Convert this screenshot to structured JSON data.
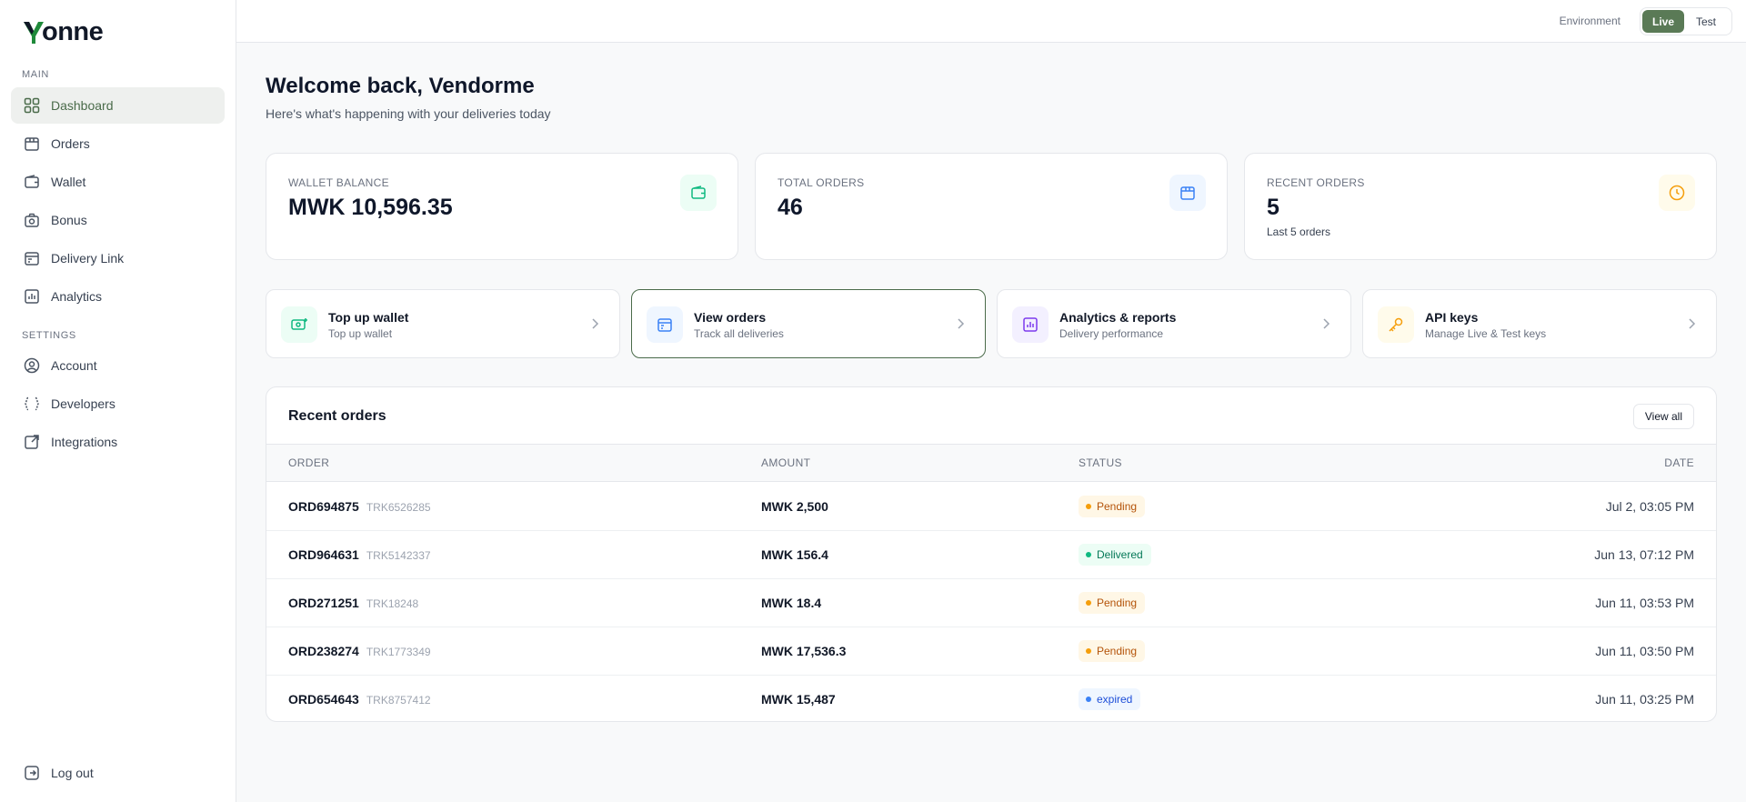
{
  "brand": {
    "name": "onne"
  },
  "sidebar": {
    "main_label": "MAIN",
    "settings_label": "SETTINGS",
    "items": [
      {
        "label": "Dashboard",
        "icon": "grid-icon",
        "active": true
      },
      {
        "label": "Orders",
        "icon": "package-icon"
      },
      {
        "label": "Wallet",
        "icon": "wallet-icon"
      },
      {
        "label": "Bonus",
        "icon": "gift-icon"
      },
      {
        "label": "Delivery Link",
        "icon": "calendar-icon"
      },
      {
        "label": "Analytics",
        "icon": "bar-chart-icon"
      }
    ],
    "settings_items": [
      {
        "label": "Account",
        "icon": "user-circle-icon"
      },
      {
        "label": "Developers",
        "icon": "code-braces-icon"
      },
      {
        "label": "Integrations",
        "icon": "external-link-icon"
      }
    ],
    "logout_label": "Log out"
  },
  "topbar": {
    "env_label": "Environment",
    "live_label": "Live",
    "test_label": "Test"
  },
  "welcome": {
    "title": "Welcome back, Vendorme",
    "subtitle": "Here's what's happening with your deliveries today"
  },
  "stats": [
    {
      "label": "WALLET BALANCE",
      "value": "MWK 10,596.35",
      "sub": "",
      "icon": "wallet-icon",
      "color": "#10b981"
    },
    {
      "label": "TOTAL ORDERS",
      "value": "46",
      "sub": "",
      "icon": "package-icon",
      "color": "#3b82f6"
    },
    {
      "label": "RECENT ORDERS",
      "value": "5",
      "sub": "Last 5 orders",
      "icon": "clock-icon",
      "color": "#f59e0b"
    }
  ],
  "actions": [
    {
      "title": "Top up wallet",
      "sub": "Top up wallet",
      "icon": "money-plus-icon"
    },
    {
      "title": "View orders",
      "sub": "Track all deliveries",
      "icon": "package-icon"
    },
    {
      "title": "Analytics & reports",
      "sub": "Delivery performance",
      "icon": "bar-chart-icon"
    },
    {
      "title": "API keys",
      "sub": "Manage Live & Test keys",
      "icon": "key-icon"
    }
  ],
  "orders": {
    "title": "Recent orders",
    "view_all": "View all",
    "columns": [
      "ORDER",
      "AMOUNT",
      "STATUS",
      "DATE"
    ],
    "rows": [
      {
        "order": "ORD694875",
        "trk": "TRK6526285",
        "amount": "MWK 2,500",
        "status": "Pending",
        "date": "Jul 2, 03:05 PM"
      },
      {
        "order": "ORD964631",
        "trk": "TRK5142337",
        "amount": "MWK 156.4",
        "status": "Delivered",
        "date": "Jun 13, 07:12 PM"
      },
      {
        "order": "ORD271251",
        "trk": "TRK18248",
        "amount": "MWK 18.4",
        "status": "Pending",
        "date": "Jun 11, 03:53 PM"
      },
      {
        "order": "ORD238274",
        "trk": "TRK1773349",
        "amount": "MWK 17,536.3",
        "status": "Pending",
        "date": "Jun 11, 03:50 PM"
      },
      {
        "order": "ORD654643",
        "trk": "TRK8757412",
        "amount": "MWK 15,487",
        "status": "expired",
        "date": "Jun 11, 03:25 PM"
      }
    ]
  },
  "colors": {
    "accent": "#5a7a56",
    "pending_bg": "#fff7e6",
    "pending_fg": "#b45309",
    "pending_dot": "#f59e0b",
    "delivered_bg": "#ecfdf5",
    "delivered_fg": "#047857",
    "delivered_dot": "#10b981",
    "expired_bg": "#eff6ff",
    "expired_fg": "#1d4ed8",
    "expired_dot": "#3b82f6"
  }
}
